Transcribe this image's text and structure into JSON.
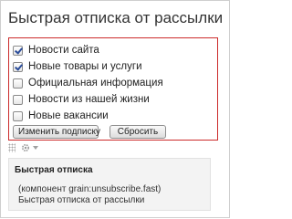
{
  "page": {
    "title": "Быстрая отписка от рассылки"
  },
  "subscriptions": [
    {
      "label": "Новости сайта",
      "checked": true
    },
    {
      "label": "Новые товары и услуги",
      "checked": true
    },
    {
      "label": "Официальная информация",
      "checked": false
    },
    {
      "label": "Новости из нашей жизни",
      "checked": false
    },
    {
      "label": "Новые вакансии",
      "checked": false
    }
  ],
  "buttons": {
    "change": "Изменить подписку",
    "reset": "Сбросить"
  },
  "toolbar": {
    "icons": [
      "grip-icon",
      "gear-icon",
      "chevron-down-icon"
    ]
  },
  "component_info": {
    "title": "Быстрая отписка",
    "component_line": "(компонент grain:unsubscribe.fast)",
    "description": "Быстрая отписка от рассылки"
  },
  "colors": {
    "form_border": "#cc2b2b",
    "checkmark": "#2a4c9a",
    "info_background": "#f3f3f3"
  }
}
